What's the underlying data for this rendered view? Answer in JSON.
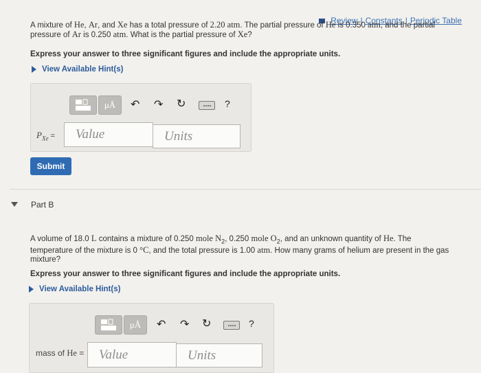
{
  "top_links": {
    "review": "Review",
    "constants": "Constants",
    "periodic": "Periodic Table",
    "sep": "|"
  },
  "partA": {
    "problem_line1_a": "A mixture of ",
    "He": "He",
    "Ar": "Ar",
    "and": ", and ",
    "Xe": "Xe",
    "problem_line1_b": " has a total pressure of ",
    "total_pressure": "2.20 atm",
    "problem_line1_c": ". The partial pressure of ",
    "He2": "He",
    "problem_line1_d": " is 0.350 ",
    "atm1": "atm",
    "problem_line1_e": ", and the partial",
    "problem_line2_a": "pressure of ",
    "Ar2": "Ar",
    "problem_line2_b": " is 0.250 ",
    "atm2": "atm",
    "problem_line2_c": ". What is the partial pressure of ",
    "Xe2": "Xe",
    "problem_line2_d": "?",
    "instructions": "Express your answer to three significant figures and include the appropriate units.",
    "hint": "View Available Hint(s)",
    "answer_label": "P",
    "answer_label_sub": "Xe",
    "answer_eq": " =",
    "value_placeholder": "Value",
    "units_placeholder": "Units",
    "submit": "Submit"
  },
  "toolbar": {
    "mu": "μÅ",
    "undo": "↶",
    "redo": "↷",
    "reset": "↻",
    "help": "?"
  },
  "partB": {
    "title": "Part B",
    "line1_a": "A volume of 18.0 ",
    "L": "L",
    "line1_b": " contains a mixture of 0.250 ",
    "mole1": "mole N",
    "sub2a": "2",
    "line1_c": ", 0.250 ",
    "mole2": "mole O",
    "sub2b": "2",
    "line1_d": ", and an unknown quantity of ",
    "He": "He",
    "line1_e": ". The",
    "line2_a": "temperature of the mixture is 0 ",
    "degC": "°C",
    "line2_b": ", and the total pressure is 1.00 ",
    "atm": "atm",
    "line2_c": ". How many grams of helium are present in the gas",
    "line3": "mixture?",
    "instructions": "Express your answer to three significant figures and include the appropriate units.",
    "hint": "View Available Hint(s)",
    "answer_label_a": "mass of ",
    "answer_label_b": "He",
    "answer_eq": " =",
    "value_placeholder": "Value",
    "units_placeholder": "Units"
  }
}
